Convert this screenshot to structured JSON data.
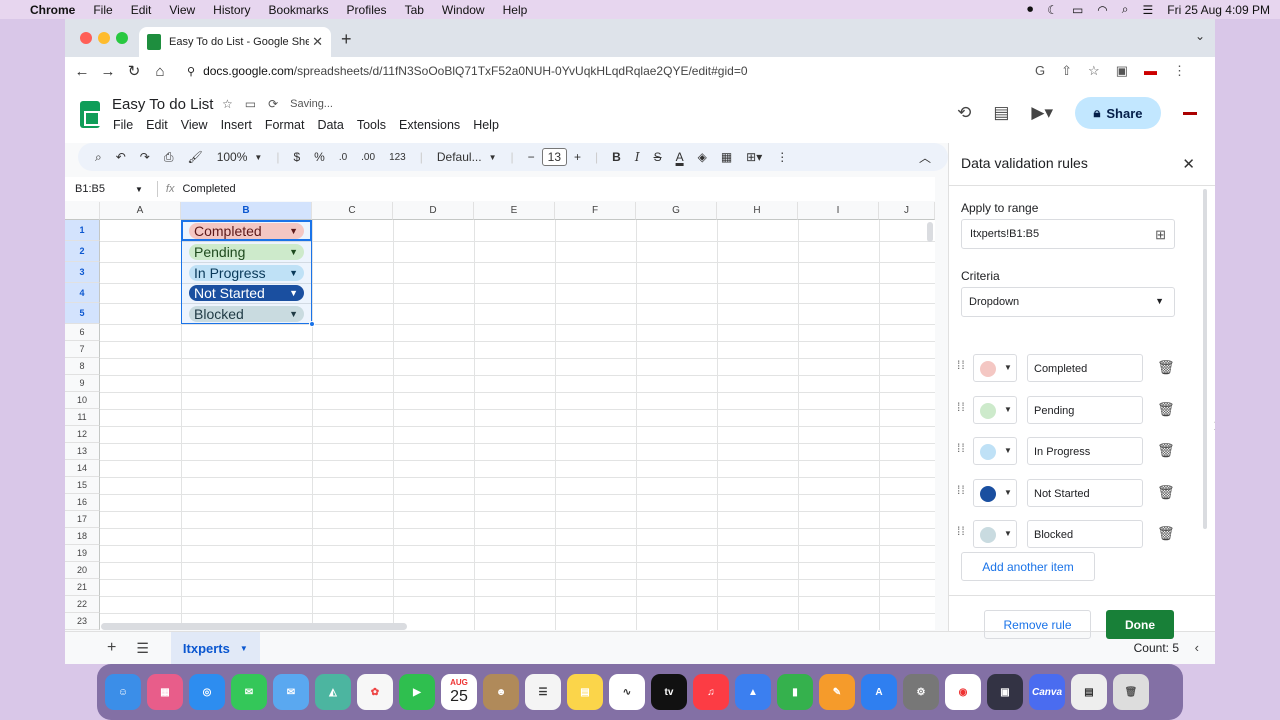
{
  "mac_menu": {
    "app": "Chrome",
    "items": [
      "File",
      "Edit",
      "View",
      "History",
      "Bookmarks",
      "Profiles",
      "Tab",
      "Window",
      "Help"
    ],
    "datetime": "Fri 25 Aug  4:09 PM"
  },
  "browser": {
    "tab_title": "Easy To do List - Google Sheets",
    "url_host": "docs.google.com",
    "url_path": "/spreadsheets/d/11fN3SoOoBlQ71TxF52a0NUH-0YvUqkHLqdRqlae2QYE/edit#gid=0"
  },
  "doc": {
    "title": "Easy To do List",
    "status": "Saving...",
    "menu": [
      "File",
      "Edit",
      "View",
      "Insert",
      "Format",
      "Data",
      "Tools",
      "Extensions",
      "Help"
    ],
    "share_label": "Share"
  },
  "format_toolbar": {
    "zoom": "100%",
    "currency": "$",
    "percent": "%",
    "dec_dec": ".0",
    "dec_inc": ".00",
    "number_fmt": "123",
    "font": "Defaul...",
    "font_size": "13"
  },
  "formula_bar": {
    "name_box": "B1:B5",
    "fx": "fx",
    "content": "Completed"
  },
  "grid": {
    "columns": [
      "A",
      "B",
      "C",
      "D",
      "E",
      "F",
      "G",
      "H",
      "I",
      "J"
    ],
    "rows": [
      "1",
      "2",
      "3",
      "4",
      "5",
      "6",
      "7",
      "8",
      "9",
      "10",
      "11",
      "12",
      "13",
      "14",
      "15",
      "16",
      "17",
      "18",
      "19",
      "20",
      "21",
      "22",
      "23"
    ],
    "chips": [
      {
        "label": "Completed",
        "bg": "#f4c7c3",
        "fg": "#5f1a1a"
      },
      {
        "label": "Pending",
        "bg": "#cdeacb",
        "fg": "#1e4a1e"
      },
      {
        "label": "In Progress",
        "bg": "#bfe1f6",
        "fg": "#0a3a5a"
      },
      {
        "label": "Not Started",
        "bg": "#1a4fa0",
        "fg": "#ffffff"
      },
      {
        "label": "Blocked",
        "bg": "#c9dbe0",
        "fg": "#1f3a44"
      }
    ]
  },
  "sheet_bar": {
    "sheet_name": "Itxperts",
    "count": "Count: 5"
  },
  "panel": {
    "title": "Data validation rules",
    "apply_label": "Apply to range",
    "range_value": "Itxperts!B1:B5",
    "criteria_label": "Criteria",
    "criteria_value": "Dropdown",
    "items": [
      {
        "value": "Completed",
        "color": "#f4c7c3"
      },
      {
        "value": "Pending",
        "color": "#cdeacb"
      },
      {
        "value": "In Progress",
        "color": "#bfe1f6"
      },
      {
        "value": "Not Started",
        "color": "#1a4fa0"
      },
      {
        "value": "Blocked",
        "color": "#c9dbe0"
      }
    ],
    "add_label": "Add another item",
    "remove_label": "Remove rule",
    "done_label": "Done"
  },
  "dock": {
    "calendar_month": "AUG",
    "calendar_day": "25",
    "tv_label": "tv",
    "canva_label": "Canva"
  }
}
